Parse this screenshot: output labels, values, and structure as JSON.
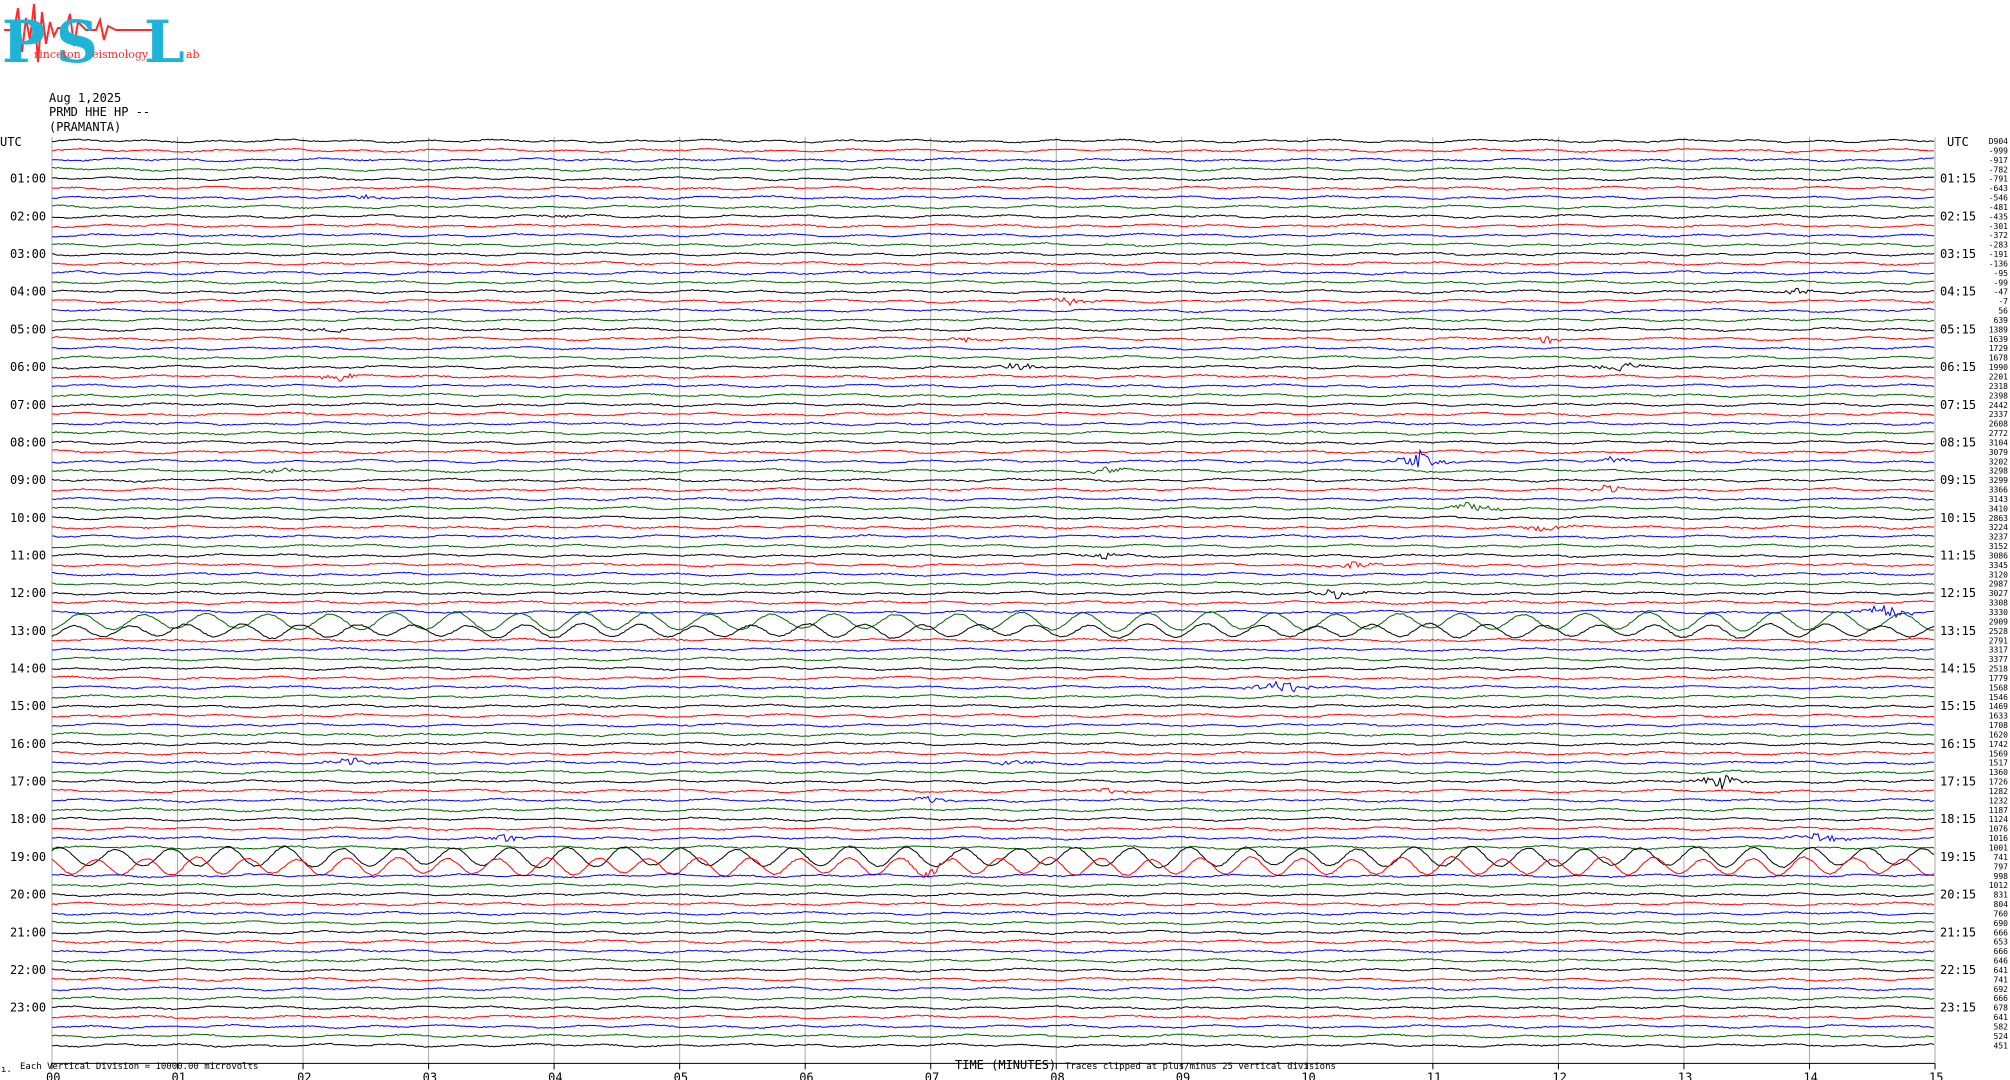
{
  "logo": {
    "letters": [
      "P",
      "S",
      "L"
    ],
    "words": [
      "rinceton",
      "eismology",
      "ab"
    ],
    "colors": {
      "letters": "#1fb3d8",
      "spike": "#ff2a2a"
    }
  },
  "header": {
    "date": "Aug 1,2025",
    "station": "PRMD HHE HP --",
    "site": "(PRAMANTA)"
  },
  "axis": {
    "utc_left": "UTC",
    "utc_right": "UTC",
    "xlabel": "TIME (MINUTES)",
    "x_ticks": [
      "00",
      "01",
      "02",
      "03",
      "04",
      "05",
      "06",
      "07",
      "08",
      "09",
      "10",
      "11",
      "12",
      "13",
      "14",
      "15"
    ],
    "left_hours": [
      "01:00",
      "02:00",
      "03:00",
      "04:00",
      "05:00",
      "06:00",
      "07:00",
      "08:00",
      "09:00",
      "10:00",
      "11:00",
      "12:00",
      "13:00",
      "14:00",
      "15:00",
      "16:00",
      "17:00",
      "18:00",
      "19:00",
      "20:00",
      "21:00",
      "22:00",
      "23:00"
    ],
    "right_hours": [
      "01:15",
      "02:15",
      "03:15",
      "04:15",
      "05:15",
      "06:15",
      "07:15",
      "08:15",
      "09:15",
      "10:15",
      "11:15",
      "12:15",
      "13:15",
      "14:15",
      "15:15",
      "16:15",
      "17:15",
      "18:15",
      "19:15",
      "20:15",
      "21:15",
      "22:15",
      "23:15"
    ]
  },
  "footer": {
    "corner": "ı.",
    "scale_note": "Each Vertical Division = 10000.00 microvolts",
    "clip_note": "Traces clipped at plus/minus 25 vertical divisions"
  },
  "colors": {
    "trace_cycle": [
      "#000000",
      "#ff0000",
      "#0000ff",
      "#006400"
    ],
    "gridline": "#aaaaaa"
  },
  "chart_data": {
    "type": "line",
    "title": "",
    "xlabel": "TIME (MINUTES)",
    "ylabel": "",
    "xlim": [
      0,
      15
    ],
    "rows_per_hour": 4,
    "row_offsets_right": [
      "D904",
      "-999",
      "-917",
      "-782",
      "-791",
      "-643",
      "-546",
      "-481",
      "-435",
      "-301",
      "-372",
      "-283",
      "-191",
      "-136",
      "-95",
      "-99",
      "-47",
      "-7",
      "56",
      "639",
      "1389",
      "1639",
      "1729",
      "1678",
      "1990",
      "2201",
      "2318",
      "2398",
      "2442",
      "2337",
      "2608",
      "2772",
      "3104",
      "3079",
      "3202",
      "3298",
      "3299",
      "3366",
      "3143",
      "3410",
      "2863",
      "3224",
      "3237",
      "3152",
      "3086",
      "3345",
      "3120",
      "2987",
      "3027",
      "3308",
      "3330",
      "2909",
      "2528",
      "2791",
      "3317",
      "3377",
      "2518",
      "1779",
      "1568",
      "1546",
      "1469",
      "1633",
      "1708",
      "1620",
      "1742",
      "1569",
      "1517",
      "1360",
      "1726",
      "1282",
      "1232",
      "1187",
      "1124",
      "1076",
      "1016",
      "1001",
      "741",
      "797",
      "998",
      "1012",
      "831",
      "804",
      "760",
      "690",
      "666",
      "653",
      "666",
      "646",
      "641",
      "741",
      "692",
      "666",
      "678",
      "641",
      "582",
      "524",
      "451"
    ],
    "events": [
      {
        "row": 6,
        "minute": 2.5,
        "amp": 3
      },
      {
        "row": 8,
        "minute": 4.0,
        "amp": 2
      },
      {
        "row": 16,
        "minute": 13.9,
        "amp": 4
      },
      {
        "row": 17,
        "minute": 8.1,
        "amp": 4
      },
      {
        "row": 20,
        "minute": 2.2,
        "amp": 4
      },
      {
        "row": 21,
        "minute": 7.3,
        "amp": 4
      },
      {
        "row": 21,
        "minute": 11.9,
        "amp": 4
      },
      {
        "row": 24,
        "minute": 7.7,
        "amp": 5
      },
      {
        "row": 24,
        "minute": 12.5,
        "amp": 6
      },
      {
        "row": 25,
        "minute": 2.3,
        "amp": 5
      },
      {
        "row": 34,
        "minute": 10.9,
        "amp": 10
      },
      {
        "row": 34,
        "minute": 12.4,
        "amp": 5
      },
      {
        "row": 35,
        "minute": 1.8,
        "amp": 4
      },
      {
        "row": 35,
        "minute": 8.4,
        "amp": 4
      },
      {
        "row": 37,
        "minute": 12.4,
        "amp": 5
      },
      {
        "row": 39,
        "minute": 11.3,
        "amp": 8
      },
      {
        "row": 41,
        "minute": 11.9,
        "amp": 4
      },
      {
        "row": 44,
        "minute": 8.4,
        "amp": 5
      },
      {
        "row": 45,
        "minute": 10.4,
        "amp": 5
      },
      {
        "row": 48,
        "minute": 10.2,
        "amp": 6
      },
      {
        "row": 50,
        "minute": 14.6,
        "amp": 10
      },
      {
        "row": 58,
        "minute": 9.8,
        "amp": 14
      },
      {
        "row": 66,
        "minute": 2.4,
        "amp": 6
      },
      {
        "row": 66,
        "minute": 7.7,
        "amp": 4
      },
      {
        "row": 68,
        "minute": 13.3,
        "amp": 9
      },
      {
        "row": 69,
        "minute": 8.4,
        "amp": 5
      },
      {
        "row": 70,
        "minute": 7.0,
        "amp": 4
      },
      {
        "row": 74,
        "minute": 3.6,
        "amp": 5
      },
      {
        "row": 74,
        "minute": 14.1,
        "amp": 7
      },
      {
        "row": 77,
        "minute": 7.0,
        "amp": 5
      }
    ],
    "swell_rows": [
      {
        "row": 51,
        "amp": 8,
        "period": 0.5
      },
      {
        "row": 52,
        "amp": 6,
        "period": 0.45
      },
      {
        "row": 76,
        "amp": 9,
        "period": 0.45
      },
      {
        "row": 77,
        "amp": 8,
        "period": 0.4
      }
    ]
  }
}
